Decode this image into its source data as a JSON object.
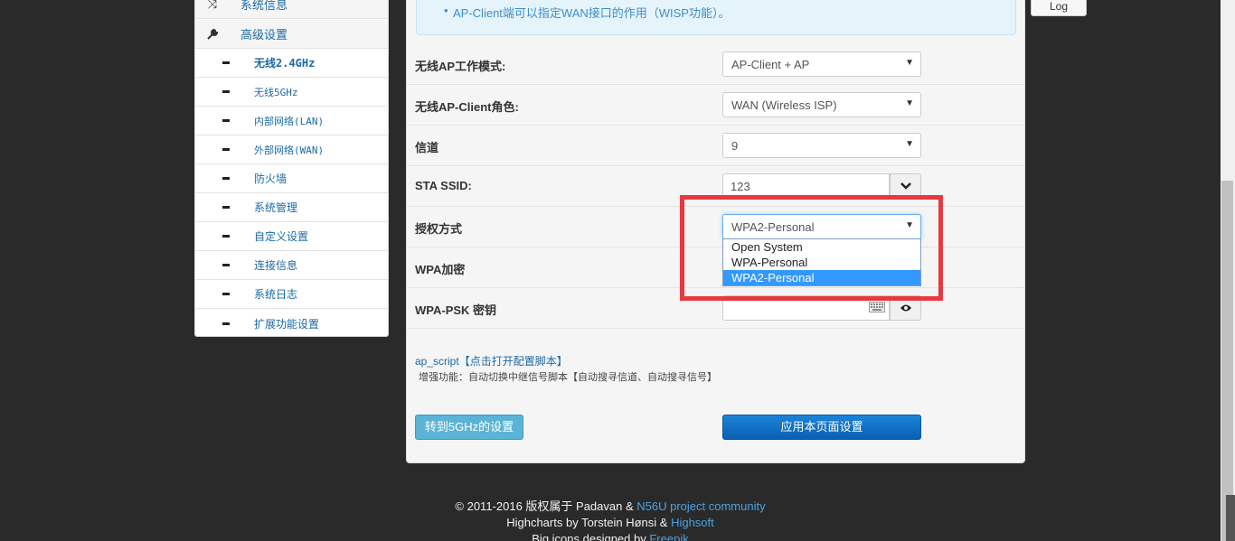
{
  "sidebar": {
    "items": [
      {
        "label": "系统信息",
        "icon": "shuffle-icon"
      },
      {
        "label": "高级设置",
        "icon": "wrench-icon"
      }
    ],
    "subitems": [
      {
        "label": "无线2.4GHz",
        "active": true
      },
      {
        "label": "无线5GHz"
      },
      {
        "label": "内部网络(LAN)"
      },
      {
        "label": "外部网络(WAN)"
      },
      {
        "label": "防火墙"
      },
      {
        "label": "系统管理"
      },
      {
        "label": "自定义设置"
      },
      {
        "label": "连接信息"
      },
      {
        "label": "系统日志"
      },
      {
        "label": "扩展功能设置"
      }
    ]
  },
  "info": {
    "note": "AP-Client端可以指定WAN接口的作用（WISP功能）。"
  },
  "form": {
    "ap_mode": {
      "label": "无线AP工作模式:",
      "value": "AP-Client + AP"
    },
    "client_role": {
      "label": "无线AP-Client角色:",
      "value": "WAN (Wireless ISP)"
    },
    "channel": {
      "label": "信道",
      "value": "9"
    },
    "sta_ssid": {
      "label": "STA SSID:",
      "value": "123"
    },
    "auth": {
      "label": "授权方式",
      "value": "WPA2-Personal",
      "options": [
        "Open System",
        "WPA-Personal",
        "WPA2-Personal"
      ]
    },
    "wpa_enc": {
      "label": "WPA加密"
    },
    "wpa_psk": {
      "label": "WPA-PSK 密钥",
      "value": ""
    }
  },
  "script": {
    "link": "ap_script",
    "link_cn": "【点击打开配置脚本】",
    "enhance": "增强功能：自动切换中继信号脚本【自动搜寻信道、自动搜寻信号】"
  },
  "buttons": {
    "goto_5g": "转到5GHz的设置",
    "apply": "应用本页面设置",
    "log": "Log"
  },
  "footer": {
    "line1_prefix": "© 2011-2016 版权属于 Padavan & ",
    "line1_link": "N56U project community",
    "line2_prefix": "Highcharts by Torstein Hønsi & ",
    "line2_link": "Highsoft",
    "line3_prefix": "Big icons designed by ",
    "line3_link": "Freepik"
  },
  "colors": {
    "highlight": "#e8393f",
    "link": "#1b6aa5",
    "selected_option": "#3399ff"
  }
}
